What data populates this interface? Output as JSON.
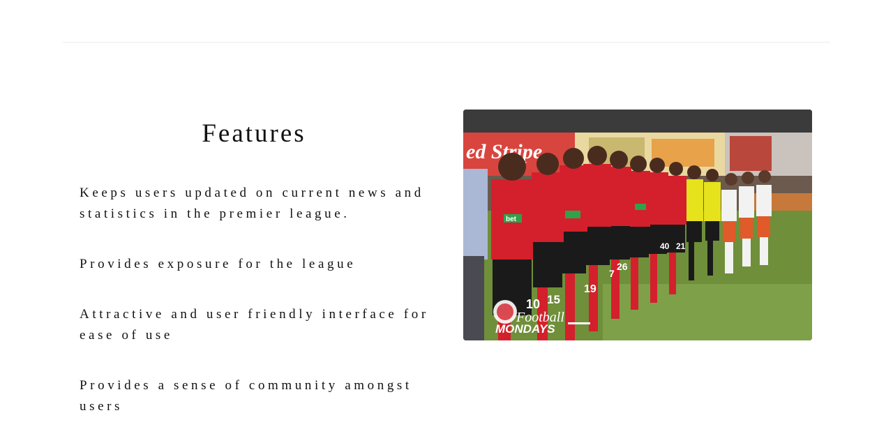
{
  "features": {
    "title": "Features",
    "items": [
      "Keeps users updated on current news and statistics in the premier league.",
      "Provides exposure for the league",
      "Attractive and user friendly interface for ease of use",
      "Provides a sense of community amongst users"
    ]
  },
  "photo": {
    "banner_text": "ed Stripe",
    "logo_line1": "Football",
    "logo_line2": "MONDAYS",
    "jersey_numbers": [
      "10",
      "15",
      "19",
      "7",
      "26",
      "40",
      "21"
    ],
    "sponsor_text": "bet",
    "colors": {
      "kit_red": "#d4202c",
      "kit_black": "#1a1a1a",
      "ref_yellow": "#e6e21c",
      "opponent_white": "#f2f2f2",
      "opponent_orange": "#e05a2a",
      "pitch_green": "#6f8f3a"
    }
  }
}
